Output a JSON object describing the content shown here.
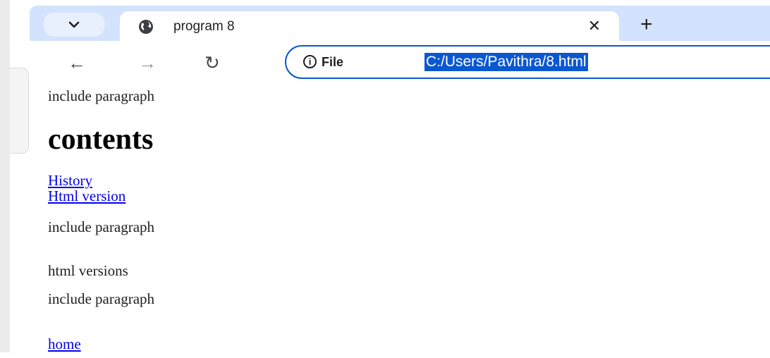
{
  "tab": {
    "title": "program 8",
    "close_glyph": "✕",
    "new_tab_glyph": "+",
    "icon": "globe-icon"
  },
  "toolbar": {
    "back_glyph": "←",
    "forward_glyph": "→",
    "reload_glyph": "↻",
    "info_glyph": "i",
    "scheme_label": "File",
    "url": "C:/Users/Pavithra/8.html"
  },
  "page": {
    "para_1": "include paragraph",
    "heading": "contents",
    "link_history": "History",
    "link_html_version": "Html version",
    "para_2": "include paragraph",
    "section_title": "html versions",
    "para_3": "include paragraph",
    "link_home": "home"
  },
  "colors": {
    "tabstrip": "#d3e3fd",
    "accent": "#0b57d0",
    "link": "#0000ee"
  }
}
